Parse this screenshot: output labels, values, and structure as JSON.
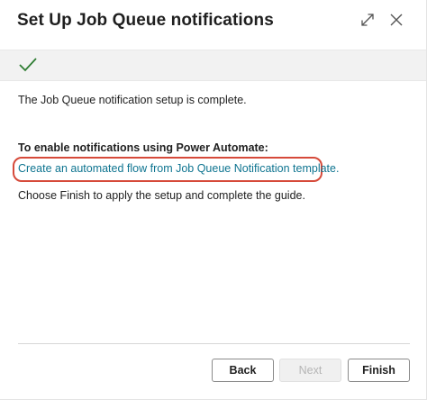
{
  "dialog": {
    "title": "Set Up Job Queue notifications",
    "icons": {
      "expand": "expand-icon",
      "close": "close-icon"
    }
  },
  "status": {
    "icon": "checkmark-icon",
    "color": "#2e7d32"
  },
  "content": {
    "complete_text": "The Job Queue notification setup is complete.",
    "heading": "To enable notifications using Power Automate:",
    "flow_link": "Create an automated flow from Job Queue Notification template.",
    "finish_note": "Choose Finish to apply the setup and complete the guide."
  },
  "buttons": {
    "back": "Back",
    "next": "Next",
    "finish": "Finish"
  },
  "colors": {
    "link": "#0e7490",
    "highlight_border": "#d64a3a"
  }
}
